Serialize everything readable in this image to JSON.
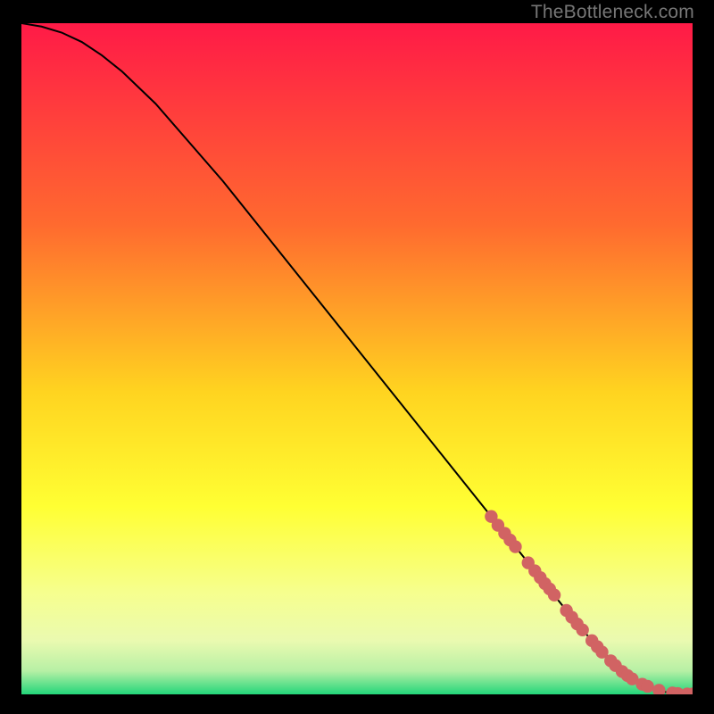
{
  "watermark": "TheBottleneck.com",
  "colors": {
    "bg": "#000000",
    "curve": "#000000",
    "marker": "#d16363",
    "grad_top": "#ff1a47",
    "grad_mid1": "#ff6a2f",
    "grad_mid2": "#ffd420",
    "grad_mid3": "#ffff33",
    "grad_mid4": "#f6ff8f",
    "grad_mid5": "#eafab0",
    "grad_mid6": "#b7f0a5",
    "grad_bot": "#23d67a"
  },
  "chart_data": {
    "type": "line",
    "title": "",
    "xlabel": "",
    "ylabel": "",
    "xlim": [
      0,
      100
    ],
    "ylim": [
      0,
      100
    ],
    "series": [
      {
        "name": "curve",
        "x": [
          0,
          3,
          6,
          9,
          12,
          15,
          20,
          30,
          40,
          50,
          60,
          70,
          78,
          82,
          85,
          88,
          90,
          92,
          94,
          96,
          98,
          100
        ],
        "y": [
          100,
          99.5,
          98.6,
          97.2,
          95.2,
          92.8,
          88.0,
          76.5,
          64.0,
          51.5,
          39.0,
          26.5,
          16.5,
          11.5,
          8.0,
          5.0,
          3.2,
          1.8,
          0.9,
          0.35,
          0.1,
          0.05
        ]
      }
    ],
    "markers": {
      "x": [
        70.0,
        71.0,
        72.0,
        72.8,
        73.6,
        75.5,
        76.5,
        77.3,
        78.0,
        78.7,
        79.4,
        81.2,
        82.0,
        82.8,
        83.6,
        85.0,
        85.8,
        86.5,
        87.8,
        88.5,
        89.5,
        90.3,
        91.0,
        92.5,
        93.3,
        95.0,
        97.0,
        97.8,
        99.2,
        100.0
      ],
      "y": [
        26.5,
        25.2,
        24.0,
        23.0,
        22.0,
        19.6,
        18.4,
        17.4,
        16.5,
        15.7,
        14.8,
        12.5,
        11.5,
        10.5,
        9.6,
        8.0,
        7.1,
        6.3,
        5.0,
        4.3,
        3.4,
        2.8,
        2.3,
        1.5,
        1.2,
        0.6,
        0.2,
        0.12,
        0.06,
        0.05
      ]
    }
  }
}
